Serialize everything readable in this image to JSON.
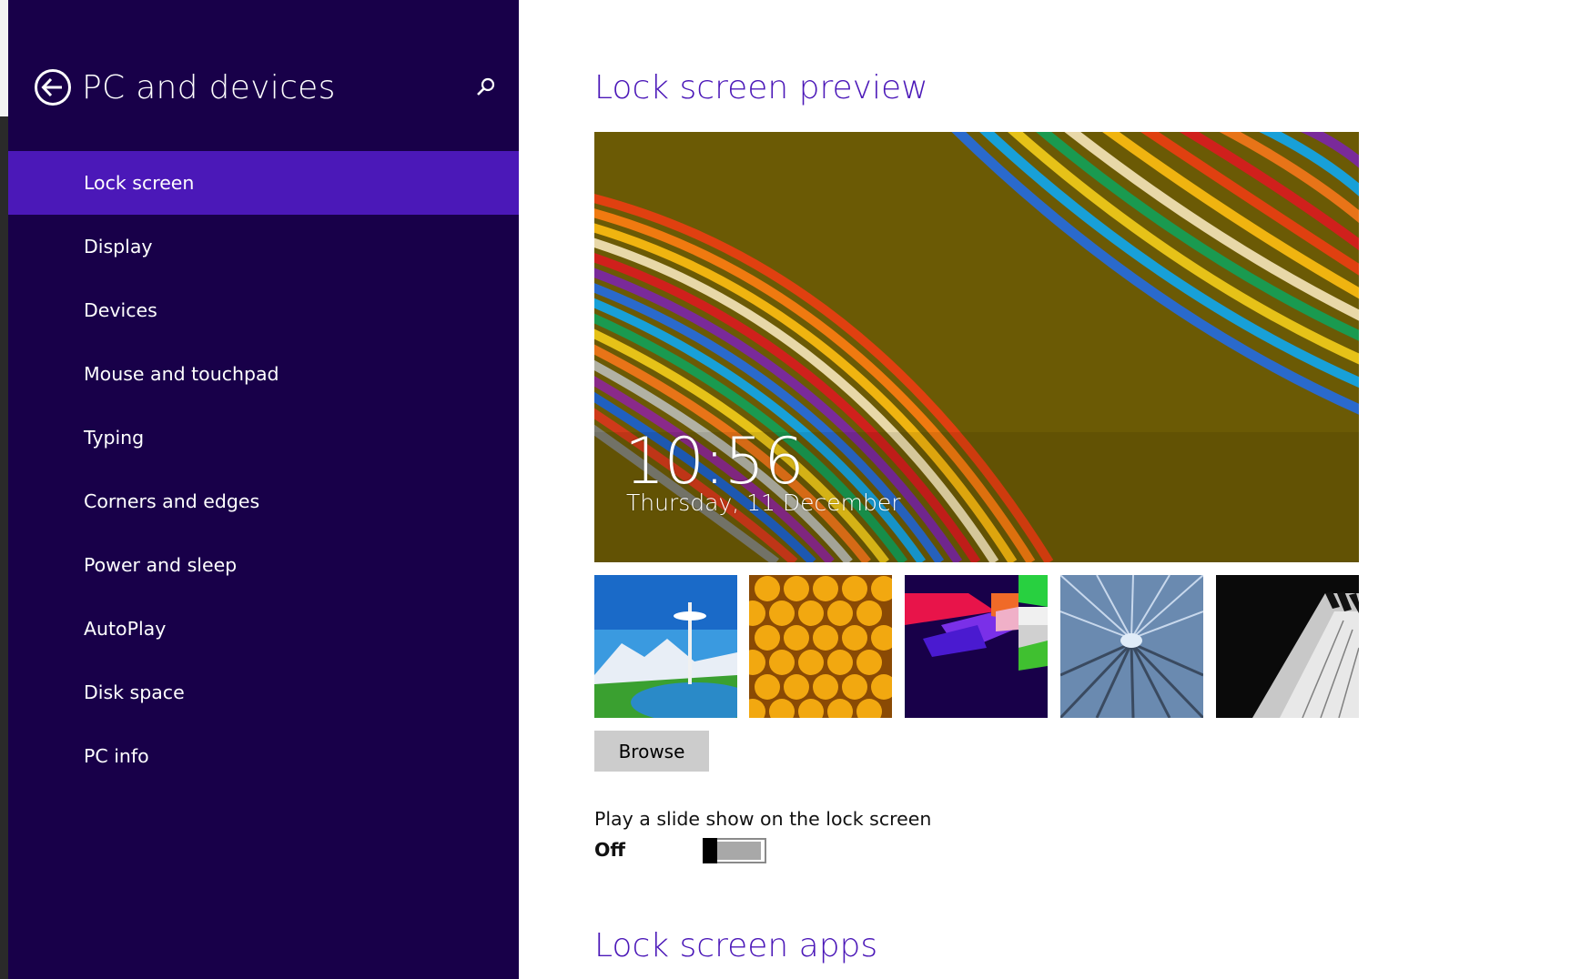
{
  "sidebar": {
    "title": "PC and devices",
    "back_icon": "back-arrow-circle-icon",
    "search_icon": "search-icon",
    "items": [
      {
        "label": "Lock screen",
        "active": true
      },
      {
        "label": "Display",
        "active": false
      },
      {
        "label": "Devices",
        "active": false
      },
      {
        "label": "Mouse and touchpad",
        "active": false
      },
      {
        "label": "Typing",
        "active": false
      },
      {
        "label": "Corners and edges",
        "active": false
      },
      {
        "label": "Power and sleep",
        "active": false
      },
      {
        "label": "AutoPlay",
        "active": false
      },
      {
        "label": "Disk space",
        "active": false
      },
      {
        "label": "PC info",
        "active": false
      }
    ]
  },
  "main": {
    "preview_heading": "Lock screen preview",
    "preview": {
      "time": "10:56",
      "date": "Thursday, 11 December"
    },
    "thumbnails": [
      {
        "name": "space-needle-landscape"
      },
      {
        "name": "yellow-honeycomb"
      },
      {
        "name": "colorful-geometric-shapes"
      },
      {
        "name": "motion-blur-tunnel"
      },
      {
        "name": "piano-keys"
      }
    ],
    "browse_label": "Browse",
    "slideshow": {
      "label": "Play a slide show on the lock screen",
      "state": "Off",
      "on": false
    },
    "apps_heading": "Lock screen apps"
  },
  "colors": {
    "sidebar_bg": "#180049",
    "accent": "#4b18b8",
    "heading": "#4b18b8",
    "button_bg": "#cccccc"
  }
}
